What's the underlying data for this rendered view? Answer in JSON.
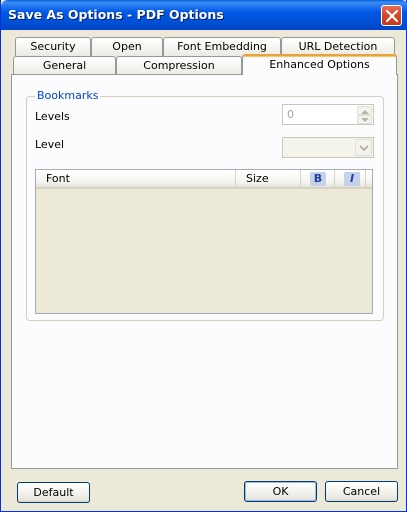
{
  "window": {
    "title": "Save As Options - PDF Options"
  },
  "tabs": {
    "row1": [
      "Security",
      "Open",
      "Font Embedding",
      "URL Detection"
    ],
    "row2": [
      "General",
      "Compression",
      "Enhanced Options"
    ],
    "active": "Enhanced Options"
  },
  "bookmarks": {
    "group_label": "Bookmarks",
    "levels_label": "Levels",
    "levels_value": "0",
    "level_label": "Level",
    "level_value": ""
  },
  "font_table": {
    "columns": {
      "font": "Font",
      "size": "Size",
      "bold": "B",
      "italic": "I"
    },
    "rows": []
  },
  "buttons": {
    "default": "Default",
    "ok": "OK",
    "cancel": "Cancel"
  },
  "colors": {
    "titlebar": "#0058e6",
    "active_tab_accent": "#e8a33a",
    "group_label": "#0046d5"
  },
  "icons": {
    "close": "close-icon",
    "spin_up": "chevron-up-icon",
    "spin_down": "chevron-down-icon",
    "dropdown": "chevron-down-icon"
  }
}
